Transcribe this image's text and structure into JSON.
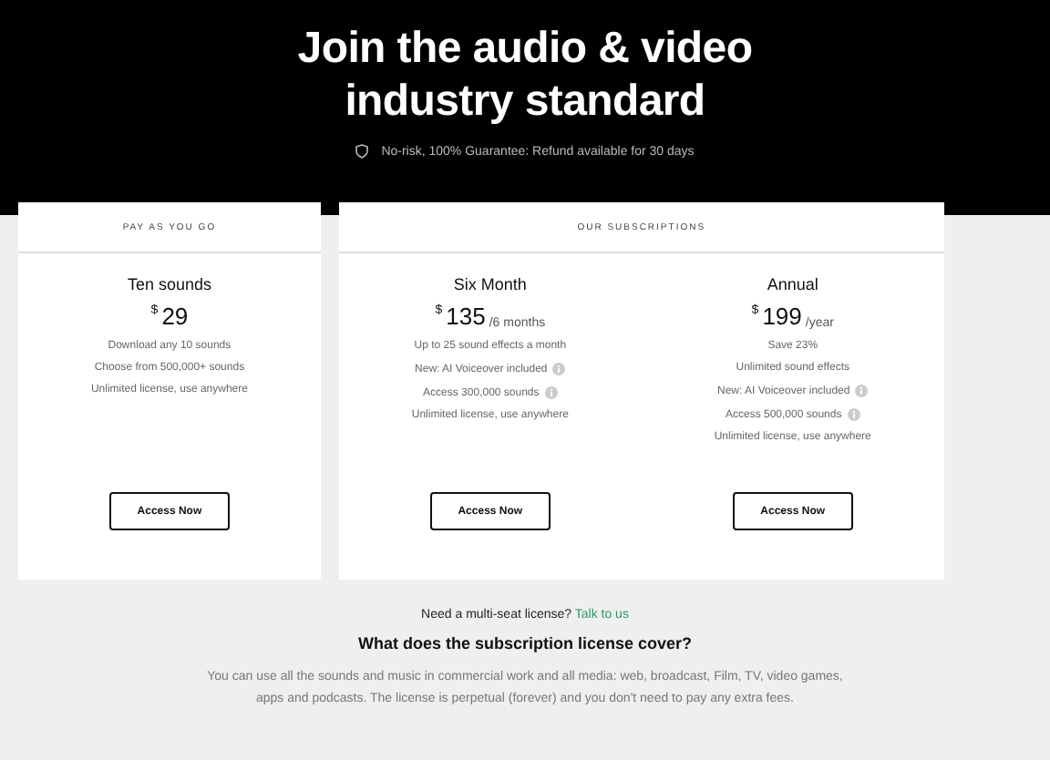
{
  "hero": {
    "title": "Join the audio & video industry standard",
    "guarantee": "No-risk, 100% Guarantee: Refund available for 30 days"
  },
  "groups": [
    {
      "label": "PAY AS YOU GO",
      "plans": [
        {
          "name": "Ten sounds",
          "currency": "$",
          "price": "29",
          "features": [
            {
              "text": "Download any 10 sounds",
              "info": false
            },
            {
              "text": "Choose from 500,000+ sounds",
              "info": false
            },
            {
              "text": "Unlimited license, use anywhere",
              "info": false
            }
          ],
          "button": "Access Now"
        }
      ]
    },
    {
      "label": "OUR SUBSCRIPTIONS",
      "plans": [
        {
          "name": "Six Month",
          "currency": "$",
          "price": "135",
          "period": "/6 months",
          "features": [
            {
              "text": "Up to 25 sound effects a month",
              "info": false
            },
            {
              "text": "New: AI Voiceover included",
              "info": true
            },
            {
              "text": "Access 300,000 sounds",
              "info": true
            },
            {
              "text": "Unlimited license, use anywhere",
              "info": false
            }
          ],
          "button": "Access Now"
        },
        {
          "name": "Annual",
          "currency": "$",
          "price": "199",
          "period": "/year",
          "features": [
            {
              "text": "Save 23%",
              "info": false
            },
            {
              "text": "Unlimited sound effects",
              "info": false
            },
            {
              "text": "New: AI Voiceover included",
              "info": true
            },
            {
              "text": "Access 500,000 sounds",
              "info": true
            },
            {
              "text": "Unlimited license, use anywhere",
              "info": false
            }
          ],
          "button": "Access Now"
        }
      ]
    }
  ],
  "contact": {
    "text": "Need a multi-seat license?",
    "link": "Talk to us"
  },
  "faq": {
    "question": "What does the subscription license cover?",
    "answer": "You can use all the sounds and music in commercial work and all media: web, broadcast, Film, TV, video games, apps and podcasts. The license is perpetual (forever) and you don't need to pay any extra fees."
  }
}
